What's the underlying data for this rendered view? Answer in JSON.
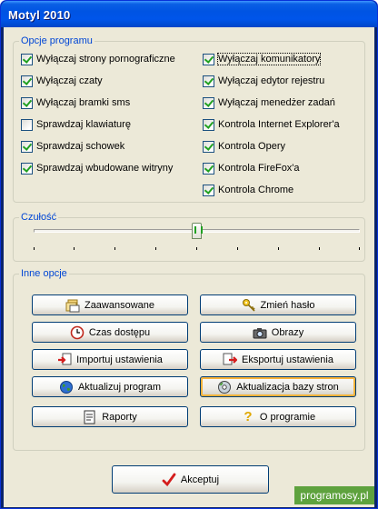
{
  "window": {
    "title": "Motyl 2010"
  },
  "options": {
    "legend": "Opcje programu",
    "left": [
      {
        "label": "Wyłączaj strony pornograficzne",
        "checked": true
      },
      {
        "label": "Wyłączaj czaty",
        "checked": true
      },
      {
        "label": "Wyłączaj bramki sms",
        "checked": true
      },
      {
        "label": "Sprawdzaj klawiaturę",
        "checked": false
      },
      {
        "label": "Sprawdzaj schowek",
        "checked": true
      },
      {
        "label": "Sprawdzaj wbudowane witryny",
        "checked": true
      }
    ],
    "right": [
      {
        "label": "Wyłączaj komunikatory",
        "checked": true
      },
      {
        "label": "Wyłączaj edytor rejestru",
        "checked": true
      },
      {
        "label": "Wyłączaj menedżer zadań",
        "checked": true
      },
      {
        "label": "Kontrola Internet Explorer'a",
        "checked": true
      },
      {
        "label": "Kontrola Opery",
        "checked": true
      },
      {
        "label": "Kontrola FireFox'a",
        "checked": true
      },
      {
        "label": "Kontrola Chrome",
        "checked": true
      }
    ]
  },
  "sensitivity": {
    "legend": "Czułość",
    "level": 0.5
  },
  "other": {
    "legend": "Inne opcje",
    "buttons": {
      "advanced": "Zaawansowane",
      "change_password": "Zmień hasło",
      "access_time": "Czas dostępu",
      "images": "Obrazy",
      "import": "Importuj ustawienia",
      "export": "Eksportuj ustawienia",
      "update_program": "Aktualizuj program",
      "update_sites": "Aktualizacja bazy stron",
      "reports": "Raporty",
      "about": "O programie"
    }
  },
  "accept_label": "Akceptuj",
  "watermark": "programosy.pl",
  "icons": {
    "advanced": "folders-icon",
    "change_password": "key-icon",
    "access_time": "clock-icon",
    "images": "camera-icon",
    "import": "import-icon",
    "export": "export-icon",
    "update_program": "globe-icon",
    "update_sites": "cd-icon",
    "reports": "report-icon",
    "about": "help-icon",
    "accept": "checkmark-icon"
  },
  "colors": {
    "titlebar": "#0054e3",
    "client": "#ece9d8",
    "legend": "#0046d5",
    "watermark": "#5ea23e"
  }
}
